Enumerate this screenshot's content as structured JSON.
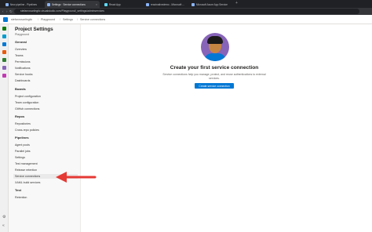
{
  "browser": {
    "tabs": [
      {
        "label": "New pipeline - Pipelines",
        "active": false
      },
      {
        "label": "Settings · Service connections",
        "active": true
      },
      {
        "label": "React App",
        "active": false
      },
      {
        "label": "reactnativedemo - Microsoft ...",
        "active": false
      },
      {
        "label": "Microsoft Azure App Service",
        "active": false
      }
    ],
    "url": "stefanrosarlingtic.visualstudio.com/Playground/_settings/adminservices",
    "new_tab": "+"
  },
  "header": {
    "org": "stefanrosarlingtic",
    "breadcrumbs": [
      "Playground",
      "Settings",
      "Service connections"
    ],
    "separator": "/"
  },
  "sidebar": {
    "title": "Project Settings",
    "subtitle": "Playground",
    "sections": [
      {
        "heading": "General",
        "items": [
          "Overview",
          "Teams",
          "Permissions",
          "Notifications",
          "Service hooks",
          "Dashboards"
        ]
      },
      {
        "heading": "Boards",
        "items": [
          "Project configuration",
          "Team configuration",
          "GitHub connections"
        ]
      },
      {
        "heading": "Repos",
        "items": [
          "Repositories",
          "Cross-repo policies"
        ]
      },
      {
        "heading": "Pipelines",
        "items": [
          "Agent pools",
          "Parallel jobs",
          "Settings",
          "Test management",
          "Release retention",
          "Service connections",
          "XAML build services"
        ]
      },
      {
        "heading": "Test",
        "items": [
          "Retention"
        ]
      }
    ],
    "selected_item": "Service connections"
  },
  "main": {
    "headline": "Create your first service connection",
    "description": "Service connections help you manage, protect, and reuse authentications to external services.",
    "button_label": "Create service connection"
  },
  "colors": {
    "accent": "#0078d4",
    "annotation": "#e53935",
    "illustration_bg": "#8764b8"
  }
}
